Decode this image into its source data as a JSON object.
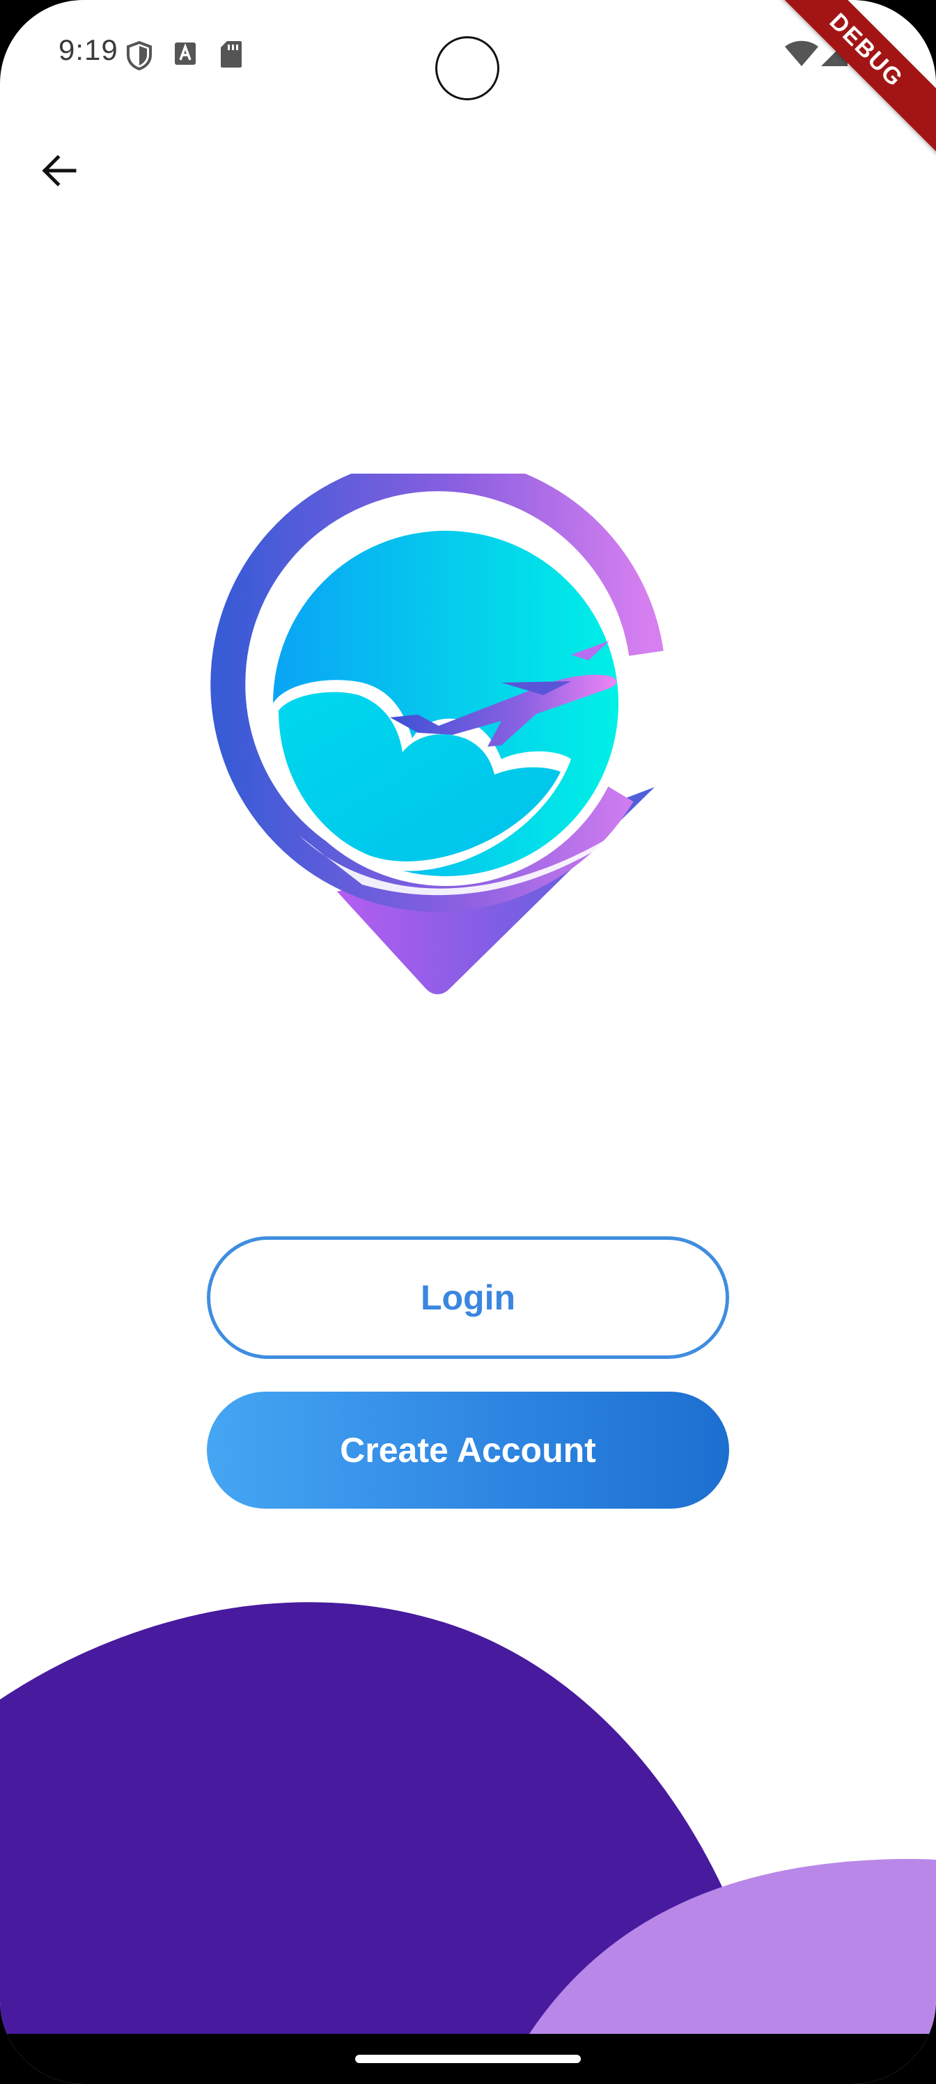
{
  "status_bar": {
    "time": "9:19",
    "icons": [
      "shield-icon",
      "a-text-icon",
      "sd-card-icon",
      "wifi-icon",
      "signal-icon",
      "battery-icon"
    ],
    "debug_label": "DEBUG"
  },
  "header": {
    "back_icon": "arrow-left-icon"
  },
  "logo": {
    "icon": "travel-airplane-location-pin-logo"
  },
  "actions": {
    "login_label": "Login",
    "create_account_label": "Create Account"
  },
  "colors": {
    "primary_blue": "#3A86E0",
    "gradient_start": "#45A6F3",
    "gradient_end": "#1C6FD0",
    "deep_purple": "#471A9E",
    "light_purple": "#B987E8",
    "debug_red": "#A31515"
  }
}
